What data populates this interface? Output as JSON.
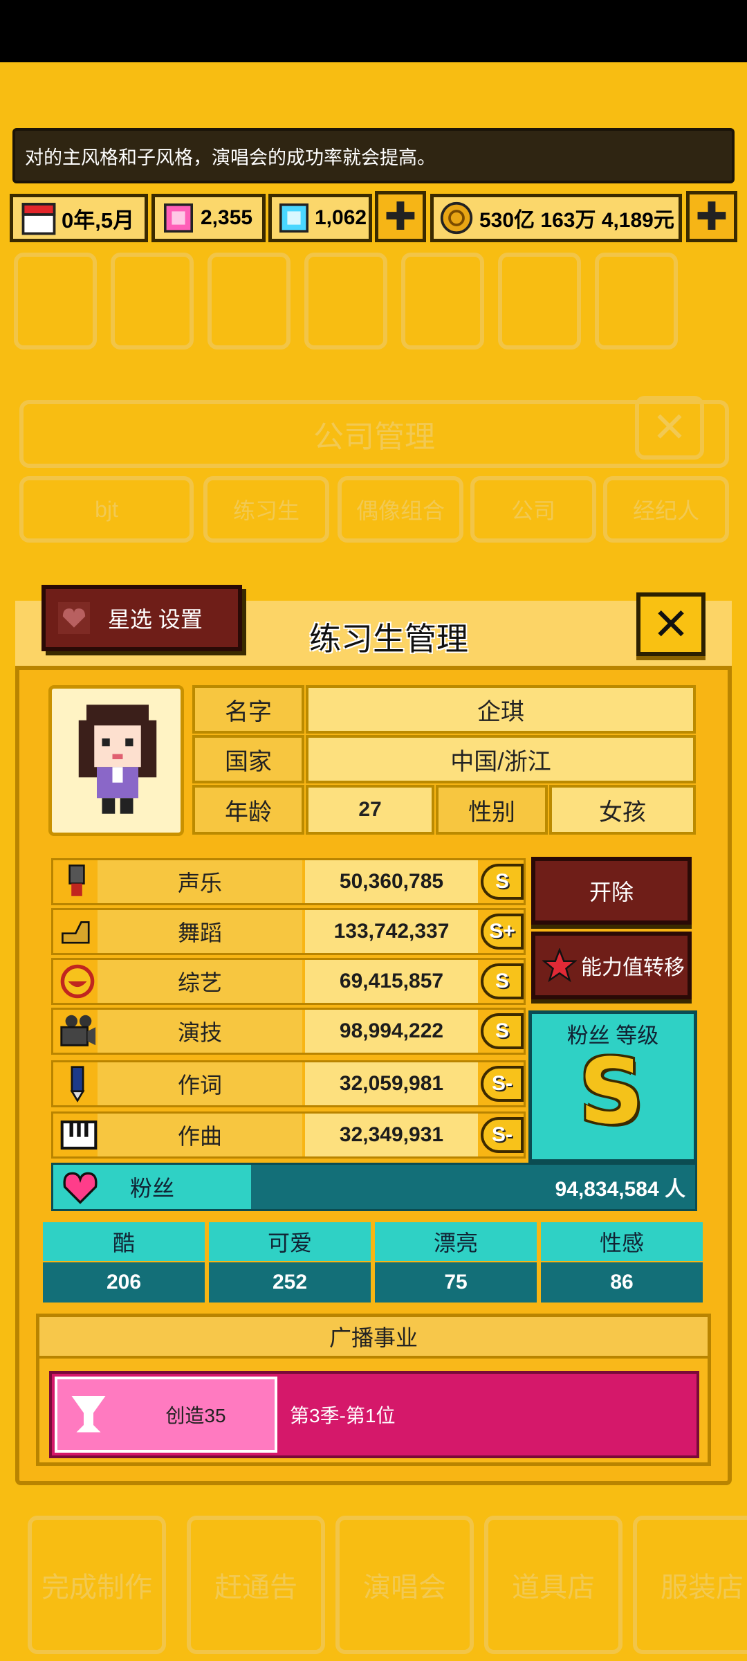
{
  "banner": {
    "text": "对的主风格和子风格，演唱会的成功率就会提高。"
  },
  "resources": {
    "date": "0年,5月",
    "gems_pink": "2,355",
    "gems_blue": "1,062",
    "money": "530亿 163万 4,189元"
  },
  "background": {
    "title": "公司管理",
    "tabs": [
      "bjt",
      "练习生",
      "偶像组合",
      "公司",
      "经纪人"
    ],
    "bottom_nav": [
      "完成制作",
      "赶通告",
      "演唱会",
      "道具店",
      "服装店"
    ]
  },
  "dialog": {
    "title": "练习生管理",
    "star_button": "星选 设置",
    "profile": {
      "name_label": "名字",
      "name": "企琪",
      "country_label": "国家",
      "country": "中国/浙江",
      "age_label": "年龄",
      "age": "27",
      "gender_label": "性别",
      "gender": "女孩"
    },
    "stats": [
      {
        "label": "声乐",
        "value": "50,360,785",
        "grade": "S",
        "icon": "microphone-icon"
      },
      {
        "label": "舞蹈",
        "value": "133,742,337",
        "grade": "S+",
        "icon": "shoe-icon"
      },
      {
        "label": "综艺",
        "value": "69,415,857",
        "grade": "S",
        "icon": "smiley-icon"
      },
      {
        "label": "演技",
        "value": "98,994,222",
        "grade": "S",
        "icon": "camera-icon"
      },
      {
        "label": "作词",
        "value": "32,059,981",
        "grade": "S-",
        "icon": "pen-icon"
      },
      {
        "label": "作曲",
        "value": "32,349,931",
        "grade": "S-",
        "icon": "piano-icon"
      }
    ],
    "fans": {
      "label": "粉丝",
      "value": "94,834,584 人"
    },
    "fire_button": "开除",
    "transfer_button": "能力值转移",
    "fan_level": {
      "label": "粉丝 等级",
      "grade": "S"
    },
    "attributes": [
      {
        "label": "酷",
        "value": "206"
      },
      {
        "label": "可爱",
        "value": "252"
      },
      {
        "label": "漂亮",
        "value": "75"
      },
      {
        "label": "性感",
        "value": "86"
      }
    ],
    "broadcast": {
      "title": "广播事业",
      "show": "创造35",
      "result": "第3季-第1位"
    }
  },
  "colors": {
    "background": "#f8bd12",
    "dark_red": "#6f1e18",
    "teal": "#2fd1c5",
    "teal_dark": "#136f78",
    "pink": "#d5186a"
  }
}
